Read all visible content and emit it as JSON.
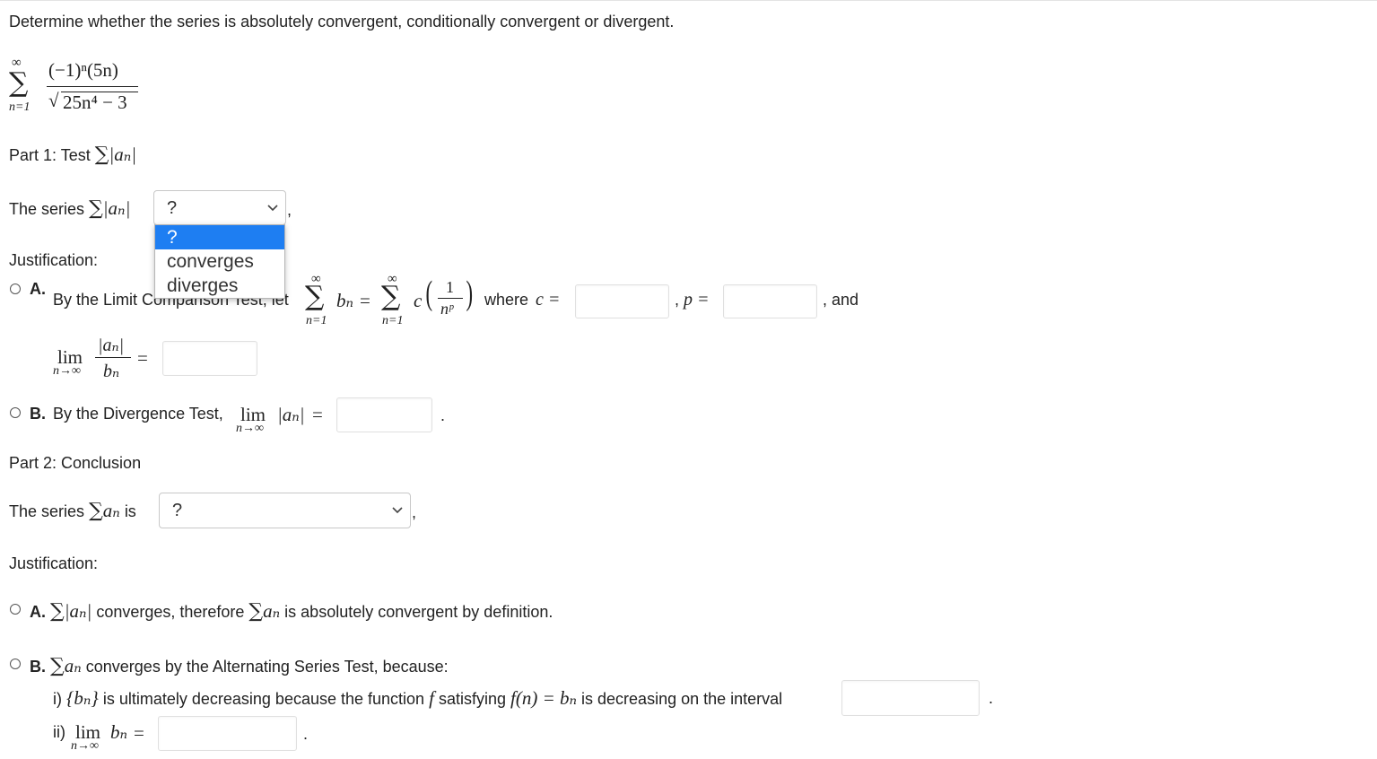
{
  "question": {
    "prompt": "Determine whether the series is absolutely convergent, conditionally convergent or divergent."
  },
  "series": {
    "numerator": "(−1)ⁿ(5n)",
    "denominator": "25n⁴ − 3",
    "upper_limit": "∞",
    "lower_limit": "n=1"
  },
  "part1": {
    "title_text": "Part 1: Test",
    "abs_term": "|aₙ|",
    "statement_prefix": "The series",
    "select": {
      "value": "?",
      "options": [
        "?",
        "converges",
        "diverges"
      ],
      "open": true,
      "highlighted": "?"
    },
    "after_select": ",",
    "justification_label": "Justification:",
    "option_a": {
      "letter": "A.",
      "text_before": "By the Limit Comparison Test, let",
      "bn": "bₙ",
      "eq": "=",
      "c": "c",
      "one": "1",
      "np": "nᵖ",
      "where_text": "where",
      "c_eq": "c =",
      "p_prefix": ",",
      "p_eq": "p =",
      "and_text": ", and",
      "lim_text": "lim",
      "lim_sub": "n→∞",
      "lim_num": "|aₙ|",
      "lim_den": "bₙ",
      "lim_eq": "="
    },
    "option_b": {
      "letter": "B.",
      "text": "By the Divergence Test,",
      "lim_text": "lim",
      "lim_sub": "n→∞",
      "abs": "|aₙ|",
      "eq": "=",
      "period": "."
    }
  },
  "part2": {
    "title": "Part 2: Conclusion",
    "statement_prefix": "The series",
    "an": "aₙ",
    "is_text": "is",
    "select": {
      "value": "?"
    },
    "after_select": ",",
    "justification_label": "Justification:",
    "option_a": {
      "letter": "A.",
      "abs": "|aₙ|",
      "mid_text": "converges, therefore",
      "an": "aₙ",
      "end_text": "is absolutely convergent by definition."
    },
    "option_b": {
      "letter": "B.",
      "an": "aₙ",
      "text": "converges by the Alternating Series Test, because:",
      "i_prefix": "i)",
      "bn_set": "{bₙ}",
      "i_text": "is ultimately decreasing because the function",
      "f": "f",
      "satisfying": "satisfying",
      "fn_eq": "f(n) = bₙ",
      "i_end": "is decreasing on the interval",
      "i_period": ".",
      "ii_prefix": "ii)",
      "lim_text": "lim",
      "lim_sub": "n→∞",
      "bn": "bₙ",
      "eq": "=",
      "ii_period": "."
    }
  },
  "symbols": {
    "sigma": "∑"
  },
  "colors": {
    "dropdown_highlight": "#1e7ef2",
    "input_border": "#e0e0e0"
  }
}
